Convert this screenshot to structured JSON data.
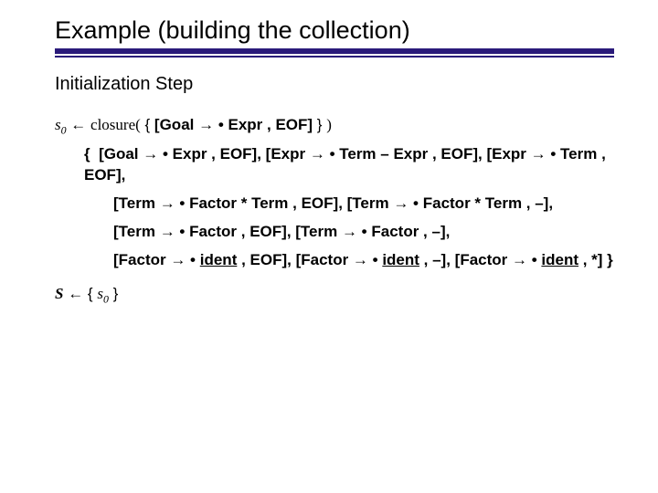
{
  "title": "Example (building the collection)",
  "subhead": "Initialization Step",
  "s0_line": {
    "lhs_var": "s",
    "lhs_sub": "0",
    "assign": " ← ",
    "closure_word": "closure(",
    "set_open": " { ",
    "item": "[Goal → • Expr , EOF]",
    "set_close": " } ",
    "paren_close": ")"
  },
  "items_open": "{",
  "items": [
    "[Goal → • Expr , EOF], [Expr → • Term – Expr , EOF], [Expr → • Term , EOF],",
    "[Term → • Factor * Term , EOF], [Term → • Factor * Term , –],",
    "[Term → • Factor , EOF], [Term → • Factor , –],"
  ],
  "items_last": {
    "p1": "[Factor → • ",
    "id1": "ident",
    "p2": " , EOF],  [Factor → • ",
    "id2": "ident",
    "p3": " , –], [Factor → • ",
    "id3": "ident",
    "p4": " , *]  }"
  },
  "S_line": {
    "S": "S",
    "assign": " ← ",
    "open": "{ ",
    "var": "s",
    "sub": "0",
    "close": " }"
  }
}
